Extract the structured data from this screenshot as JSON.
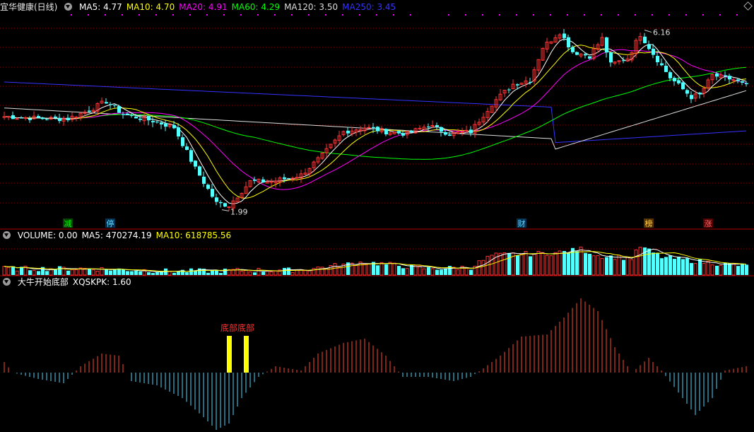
{
  "main_header": {
    "title": "宜华健康(日线)",
    "indicators": [
      {
        "label": "MA5: 4.77",
        "color": "#ffffff"
      },
      {
        "label": "MA10: 4.70",
        "color": "#ffff00"
      },
      {
        "label": "MA20: 4.91",
        "color": "#ff00ff"
      },
      {
        "label": "MA60: 4.29",
        "color": "#00ff00"
      },
      {
        "label": "MA120: 3.50",
        "color": "#dddddd"
      },
      {
        "label": "MA250: 3.45",
        "color": "#3333ff"
      }
    ]
  },
  "volume_header": {
    "indicators": [
      {
        "label": "VOLUME: 0.00",
        "color": "#ffffff"
      },
      {
        "label": "MA5: 470274.19",
        "color": "#ffffff"
      },
      {
        "label": "MA10: 618785.56",
        "color": "#ffff00"
      }
    ]
  },
  "osc_header": {
    "indicators": [
      {
        "label": "大牛开始底部",
        "color": "#ffffff"
      },
      {
        "label": "XQSKPK: 1.60",
        "color": "#ffffff"
      }
    ]
  },
  "annotations": {
    "high_label": "6.16",
    "low_label": "1.99",
    "bottom_text": "底部底部",
    "tags": [
      {
        "text": "减",
        "color": "#00ff00",
        "bg": "#004400"
      },
      {
        "text": "停",
        "color": "#5ad8ff",
        "bg": "#003355"
      },
      {
        "text": "财",
        "color": "#5ad8ff",
        "bg": "#003355"
      },
      {
        "text": "榜",
        "color": "#ffcc44",
        "bg": "#553300"
      },
      {
        "text": "涨",
        "color": "#ff6666",
        "bg": "#550000"
      }
    ]
  },
  "colors": {
    "up": "#ff3333",
    "down": "#54ffff",
    "ma5": "#ffffff",
    "ma10": "#ffff00",
    "ma20": "#ff00ff",
    "ma60": "#00ff00",
    "ma120": "#dddddd",
    "ma250": "#3333ff",
    "grid": "#8b0000",
    "osc_pos": "#ff4a2a",
    "osc_neg": "#4ad8ff",
    "osc_mark": "#ffff00"
  },
  "chart_data": {
    "type": "candlestick",
    "title": "宜华健康(日线)",
    "price_range": [
      1.6,
      6.5
    ],
    "price_anchors": [
      {
        "i": 0,
        "p": 4.1
      },
      {
        "i": 10,
        "p": 4.05
      },
      {
        "i": 15,
        "p": 4.05
      },
      {
        "i": 20,
        "p": 4.25
      },
      {
        "i": 24,
        "p": 4.45
      },
      {
        "i": 28,
        "p": 4.15
      },
      {
        "i": 35,
        "p": 4.0
      },
      {
        "i": 40,
        "p": 3.85
      },
      {
        "i": 45,
        "p": 2.9
      },
      {
        "i": 50,
        "p": 2.1
      },
      {
        "i": 53,
        "p": 2.05
      },
      {
        "i": 58,
        "p": 2.6
      },
      {
        "i": 63,
        "p": 2.6
      },
      {
        "i": 70,
        "p": 2.75
      },
      {
        "i": 75,
        "p": 3.2
      },
      {
        "i": 80,
        "p": 3.75
      },
      {
        "i": 85,
        "p": 3.85
      },
      {
        "i": 90,
        "p": 3.75
      },
      {
        "i": 95,
        "p": 3.7
      },
      {
        "i": 100,
        "p": 3.9
      },
      {
        "i": 105,
        "p": 3.7
      },
      {
        "i": 110,
        "p": 3.75
      },
      {
        "i": 115,
        "p": 4.4
      },
      {
        "i": 120,
        "p": 4.85
      },
      {
        "i": 124,
        "p": 4.95
      },
      {
        "i": 127,
        "p": 5.7
      },
      {
        "i": 131,
        "p": 6.05
      },
      {
        "i": 134,
        "p": 5.6
      },
      {
        "i": 138,
        "p": 5.5
      },
      {
        "i": 141,
        "p": 5.9
      },
      {
        "i": 143,
        "p": 5.3
      },
      {
        "i": 147,
        "p": 5.45
      },
      {
        "i": 150,
        "p": 6.0
      },
      {
        "i": 153,
        "p": 5.55
      },
      {
        "i": 157,
        "p": 5.0
      },
      {
        "i": 162,
        "p": 4.55
      },
      {
        "i": 164,
        "p": 4.6
      },
      {
        "i": 167,
        "p": 5.05
      },
      {
        "i": 172,
        "p": 4.95
      },
      {
        "i": 175,
        "p": 4.8
      }
    ],
    "volume_anchors": [
      {
        "i": 0,
        "v": 0.25
      },
      {
        "i": 20,
        "v": 0.25
      },
      {
        "i": 40,
        "v": 0.15
      },
      {
        "i": 70,
        "v": 0.2
      },
      {
        "i": 75,
        "v": 0.3
      },
      {
        "i": 85,
        "v": 0.5
      },
      {
        "i": 100,
        "v": 0.25
      },
      {
        "i": 110,
        "v": 0.3
      },
      {
        "i": 115,
        "v": 0.75
      },
      {
        "i": 120,
        "v": 0.8
      },
      {
        "i": 130,
        "v": 0.85
      },
      {
        "i": 136,
        "v": 1.0
      },
      {
        "i": 140,
        "v": 0.75
      },
      {
        "i": 148,
        "v": 0.65
      },
      {
        "i": 150,
        "v": 1.1
      },
      {
        "i": 155,
        "v": 0.7
      },
      {
        "i": 165,
        "v": 0.5
      },
      {
        "i": 175,
        "v": 0.35
      }
    ],
    "oscillator_anchors": [
      {
        "i": 0,
        "v": 0.5
      },
      {
        "i": 2,
        "v": 0.0
      },
      {
        "i": 8,
        "v": -0.3
      },
      {
        "i": 14,
        "v": -0.5
      },
      {
        "i": 18,
        "v": 0.3
      },
      {
        "i": 23,
        "v": 0.9
      },
      {
        "i": 27,
        "v": 0.8
      },
      {
        "i": 30,
        "v": -0.4
      },
      {
        "i": 36,
        "v": -0.6
      },
      {
        "i": 42,
        "v": -1.2
      },
      {
        "i": 47,
        "v": -2.1
      },
      {
        "i": 50,
        "v": -2.7
      },
      {
        "i": 53,
        "v": -2.4
      },
      {
        "i": 56,
        "v": -1.2
      },
      {
        "i": 60,
        "v": -0.2
      },
      {
        "i": 64,
        "v": 0.3
      },
      {
        "i": 70,
        "v": 0.1
      },
      {
        "i": 74,
        "v": 0.9
      },
      {
        "i": 80,
        "v": 1.4
      },
      {
        "i": 85,
        "v": 1.6
      },
      {
        "i": 90,
        "v": 0.8
      },
      {
        "i": 94,
        "v": -0.2
      },
      {
        "i": 100,
        "v": -0.2
      },
      {
        "i": 106,
        "v": -0.4
      },
      {
        "i": 110,
        "v": -0.2
      },
      {
        "i": 113,
        "v": 0.2
      },
      {
        "i": 117,
        "v": 0.8
      },
      {
        "i": 122,
        "v": 1.7
      },
      {
        "i": 128,
        "v": 1.8
      },
      {
        "i": 132,
        "v": 2.6
      },
      {
        "i": 136,
        "v": 3.5
      },
      {
        "i": 140,
        "v": 2.9
      },
      {
        "i": 144,
        "v": 1.2
      },
      {
        "i": 148,
        "v": 0.0
      },
      {
        "i": 152,
        "v": 0.7
      },
      {
        "i": 155,
        "v": 0.1
      },
      {
        "i": 160,
        "v": -1.2
      },
      {
        "i": 163,
        "v": -2.0
      },
      {
        "i": 167,
        "v": -1.2
      },
      {
        "i": 170,
        "v": 0.1
      },
      {
        "i": 175,
        "v": 0.3
      }
    ],
    "oscillator_markers": [
      53,
      57
    ],
    "tag_positions": [
      15,
      25,
      122,
      152,
      166
    ]
  }
}
